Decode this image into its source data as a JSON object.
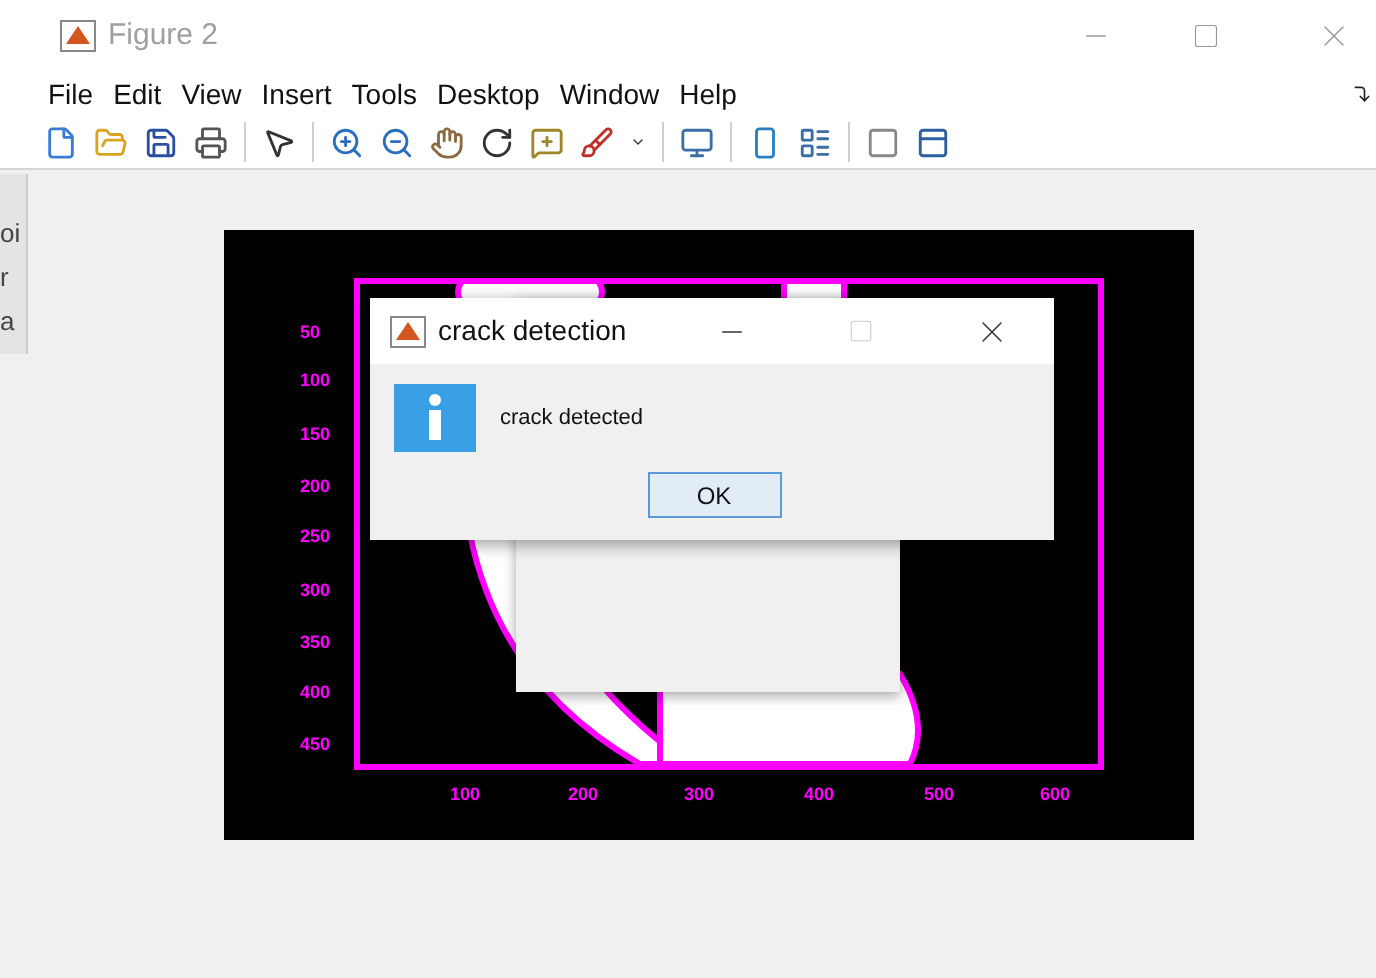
{
  "window": {
    "title": "Figure 2"
  },
  "menu": [
    "File",
    "Edit",
    "View",
    "Insert",
    "Tools",
    "Desktop",
    "Window",
    "Help"
  ],
  "side_window": {
    "texts": [
      "oi",
      "r",
      "a"
    ]
  },
  "axes": {
    "yticks": [
      "50",
      "100",
      "150",
      "200",
      "250",
      "300",
      "350",
      "400",
      "450"
    ],
    "xticks": [
      "100",
      "200",
      "300",
      "400",
      "500",
      "600"
    ]
  },
  "dialog": {
    "title": "crack detection",
    "message": "crack detected",
    "button": "OK"
  }
}
